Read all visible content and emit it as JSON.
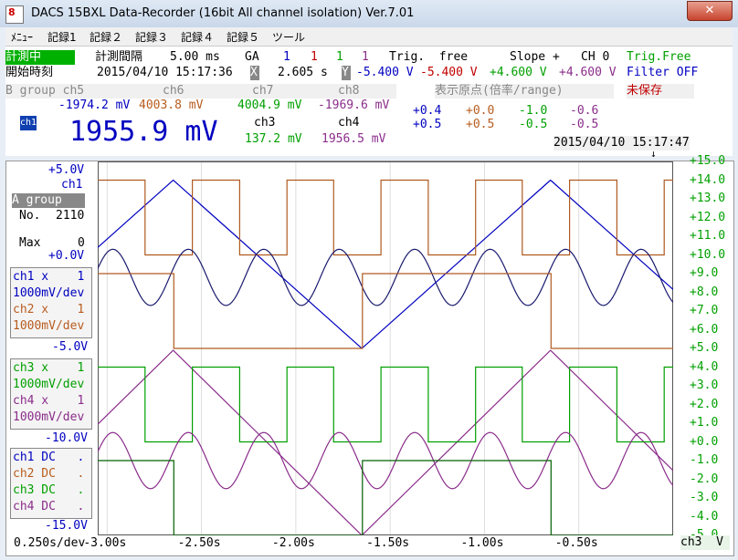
{
  "window": {
    "title": "DACS 15BXL Data-Recorder (16bit All channel isolation) Ver.7.01",
    "close": "✕",
    "icon_text": "8"
  },
  "menu": [
    "ﾒﾆｭｰ",
    "記録1",
    "記録２",
    "記録３",
    "記録４",
    "記録５",
    "ツール"
  ],
  "status": {
    "measuring": "計測中",
    "interval_label": "計測間隔",
    "interval": "5.00 ms",
    "ga_label": "GA",
    "ga_values": [
      "1",
      "1",
      "1",
      "1"
    ],
    "trig": "Trig.  free",
    "slope": "Slope +",
    "ch": "CH 0",
    "trig_free": "Trig.Free",
    "start_label": "開始時刻",
    "start_time": "2015/04/10 15:17:36",
    "x_label": "X",
    "x_value": "2.605 s",
    "y_label": "Y",
    "y_values": [
      "-5.400 V",
      "-5.400 V",
      "+4.600 V",
      "+4.600 V"
    ],
    "filter": "Filter OFF",
    "bgroup": "B group ch5",
    "bgroup_ch": [
      "ch6",
      "ch7",
      "ch8"
    ],
    "origin_label": "表示原点(倍率/range)",
    "unsaved": "未保存",
    "b_values": [
      "-1974.2 mV",
      "4003.8 mV",
      "4004.9 mV",
      "-1969.6 mV"
    ],
    "ch1_label": "ch1",
    "ch1_big": "1955.9 mV",
    "ch3_label": "ch3",
    "ch4_label": "ch4",
    "ch3_val": "137.2 mV",
    "ch4_val": "1956.5 mV",
    "origin_row1": [
      "+0.4",
      "+0.0",
      "-1.0",
      "-0.6"
    ],
    "origin_row2": [
      "+0.5",
      "+0.5",
      "-0.5",
      "-0.5"
    ],
    "timestamp": "2015/04/10 15:17:47",
    "arrow": "↓"
  },
  "left": {
    "top_v": "+5.0V",
    "ch1": "ch1",
    "agroup": "A group",
    "no_label": "No.",
    "no_value": "2110",
    "max_label": "Max",
    "max_value": "0",
    "zero": "+0.0V",
    "box1": [
      "ch1 x    1",
      "1000mV/dev",
      "ch2 x    1",
      "1000mV/dev"
    ],
    "minus5": "-5.0V",
    "box2": [
      "ch3 x    1",
      "1000mV/dev",
      "ch4 x    1",
      "1000mV/dev"
    ],
    "minus10": "-10.0V",
    "box3": [
      "ch1 DC   .",
      "ch2 DC   .",
      "ch3 DC   .",
      "ch4 DC   ."
    ],
    "minus15": "-15.0V",
    "timebase": "0.250s/dev"
  },
  "xaxis": [
    "-3.00s",
    "-2.50s",
    "-2.00s",
    "-1.50s",
    "-1.00s",
    "-0.50s"
  ],
  "yaxis_right": [
    "+15.0",
    "+14.0",
    "+13.0",
    "+12.0",
    "+11.0",
    "+10.0",
    "+9.0",
    "+8.0",
    "+7.0",
    "+6.0",
    "+5.0",
    "+4.0",
    "+3.0",
    "+2.0",
    "+1.0",
    "+0.0",
    "-1.0",
    "-2.0",
    "-3.0",
    "-4.0",
    "-5.0"
  ],
  "right_bottom": "ch3  V",
  "colors": {
    "blue": "#0000c0",
    "brown": "#b05a20",
    "green": "#00a000",
    "purple": "#8a2d8a",
    "navy": "#1a1a6e",
    "darkgreen": "#006000"
  },
  "chart_data": {
    "type": "line",
    "x_range": [
      -3.05,
      0.0
    ],
    "x_ticks": [
      -3.0,
      -2.5,
      -2.0,
      -1.5,
      -1.0,
      -0.5
    ],
    "ylim": [
      -5.0,
      15.0
    ],
    "series": [
      {
        "wave": "triangle",
        "color": "blue",
        "min": 5.0,
        "max": 14.0,
        "period": 2.0,
        "phase": 0.8
      },
      {
        "wave": "square",
        "color": "brown",
        "low": 10.0,
        "high": 14.0,
        "period": 0.5,
        "phase": 0.0
      },
      {
        "wave": "sine",
        "color": "navy",
        "center": 8.8,
        "amp": 1.5,
        "period": 0.4,
        "phase": 0.05
      },
      {
        "wave": "square",
        "color": "brown",
        "low": 5.0,
        "high": 9.0,
        "period": 2.0,
        "phase": 0.3
      },
      {
        "wave": "triangle",
        "color": "purple",
        "min": -5.0,
        "max": 4.9,
        "period": 2.0,
        "phase": 0.8
      },
      {
        "wave": "square",
        "color": "green",
        "low": 0.0,
        "high": 4.0,
        "period": 0.5,
        "phase": 0.0
      },
      {
        "wave": "sine",
        "color": "purple",
        "center": -1.0,
        "amp": 1.5,
        "period": 0.4,
        "phase": 0.05
      },
      {
        "wave": "square",
        "color": "darkgreen",
        "low": -5.0,
        "high": -1.0,
        "period": 2.0,
        "phase": 0.3
      }
    ]
  }
}
